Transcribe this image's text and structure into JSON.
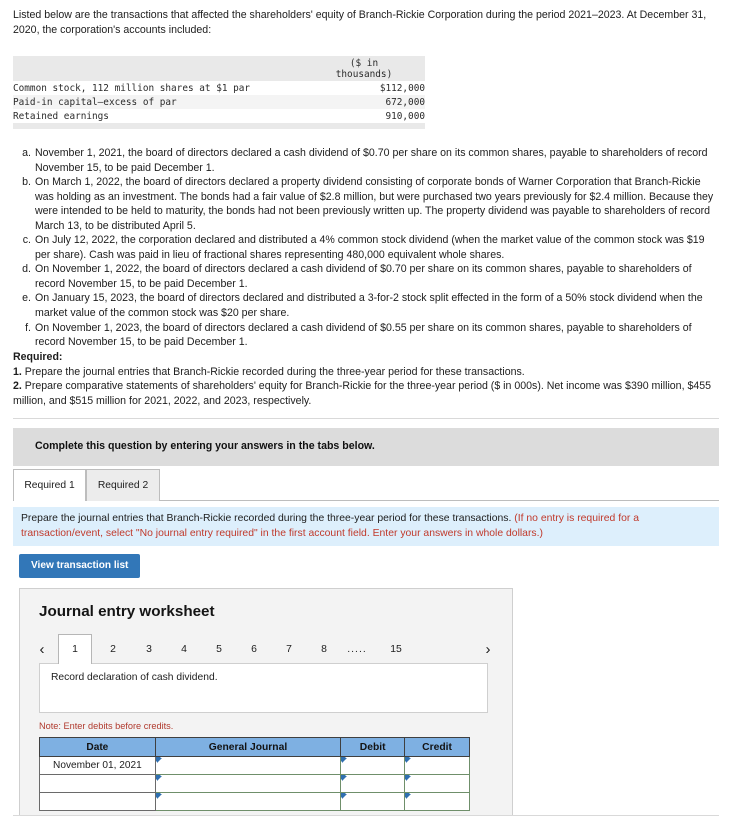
{
  "intro": {
    "paragraph": "Listed below are the transactions that affected the shareholders' equity of Branch-Rickie Corporation during the period 2021–2023. At December 31, 2020, the corporation's accounts included:"
  },
  "balances_table": {
    "unit_header_line1": "($ in",
    "unit_header_line2": "thousands)",
    "rows": [
      {
        "label": "Common stock, 112 million shares at $1 par",
        "value": "$112,000"
      },
      {
        "label": "Paid-in capital—excess of par",
        "value": "672,000"
      },
      {
        "label": "Retained earnings",
        "value": "910,000"
      }
    ]
  },
  "transactions": [
    {
      "marker": "a.",
      "text": "November 1, 2021, the board of directors declared a cash dividend of $0.70 per share on its common shares, payable to shareholders of record November 15, to be paid December 1."
    },
    {
      "marker": "b.",
      "text": "On March 1, 2022, the board of directors declared a property dividend consisting of corporate bonds of Warner Corporation that Branch-Rickie was holding as an investment. The bonds had a fair value of $2.8 million, but were purchased two years previously for $2.4 million. Because they were intended to be held to maturity, the bonds had not been previously written up. The property dividend was payable to shareholders of record March 13, to be distributed April 5."
    },
    {
      "marker": "c.",
      "text": "On July 12, 2022, the corporation declared and distributed a 4% common stock dividend (when the market value of the common stock was $19 per share). Cash was paid in lieu of fractional shares representing 480,000 equivalent whole shares."
    },
    {
      "marker": "d.",
      "text": "On November 1, 2022, the board of directors declared a cash dividend of $0.70 per share on its common shares, payable to shareholders of record November 15, to be paid December 1."
    },
    {
      "marker": "e.",
      "text": "On January 15, 2023, the board of directors declared and distributed a 3-for-2 stock split effected in the form of a 50% stock dividend when the market value of the common stock was $20 per share."
    },
    {
      "marker": "f.",
      "text": "On November 1, 2023, the board of directors declared a cash dividend of $0.55 per share on its common shares, payable to shareholders of record November 15, to be paid December 1."
    }
  ],
  "required": {
    "heading": "Required:",
    "item1_num": "1.",
    "item1_text": " Prepare the journal entries that Branch-Rickie recorded during the three-year period for these transactions.",
    "item2_num": "2.",
    "item2_text": " Prepare comparative statements of shareholders' equity for Branch-Rickie for the three-year period ($ in 000s). Net income was $390 million, $455 million, and $515 million for 2021, 2022, and 2023, respectively."
  },
  "complete_banner": {
    "text": "Complete this question by entering your answers in the tabs below."
  },
  "tabs": [
    {
      "label": "Required 1",
      "active": true
    },
    {
      "label": "Required 2",
      "active": false
    }
  ],
  "info_banner": {
    "main": "Prepare the journal entries that Branch-Rickie recorded during the three-year period for these transactions. ",
    "red": "(If no entry is required for a transaction/event, select \"No journal entry required\" in the first account field. Enter your answers in whole dollars.)"
  },
  "buttons": {
    "view_transaction_list": "View transaction list"
  },
  "worksheet": {
    "title": "Journal entry worksheet",
    "pagination": {
      "prev_icon": "chevron-left",
      "next_icon": "chevron-right",
      "pages": [
        "1",
        "2",
        "3",
        "4",
        "5",
        "6",
        "7",
        "8"
      ],
      "ellipsis": ".....",
      "last_page": "15",
      "active_page": "1"
    },
    "instruction": "Record declaration of cash dividend.",
    "note": "Note: Enter debits before credits.",
    "table": {
      "columns": [
        "Date",
        "General Journal",
        "Debit",
        "Credit"
      ],
      "rows": [
        {
          "date": "November 01, 2021",
          "general_journal": "",
          "debit": "",
          "credit": ""
        },
        {
          "date": "",
          "general_journal": "",
          "debit": "",
          "credit": ""
        },
        {
          "date": "",
          "general_journal": "",
          "debit": "",
          "credit": ""
        }
      ]
    }
  },
  "colors": {
    "accent_blue": "#3277b8",
    "table_header_blue": "#7eb0e2",
    "info_banner_blue": "#ddeffc",
    "banner_gray": "#dcdcdc",
    "panel_gray": "#f3f3f3",
    "note_red": "#b03a2e"
  }
}
